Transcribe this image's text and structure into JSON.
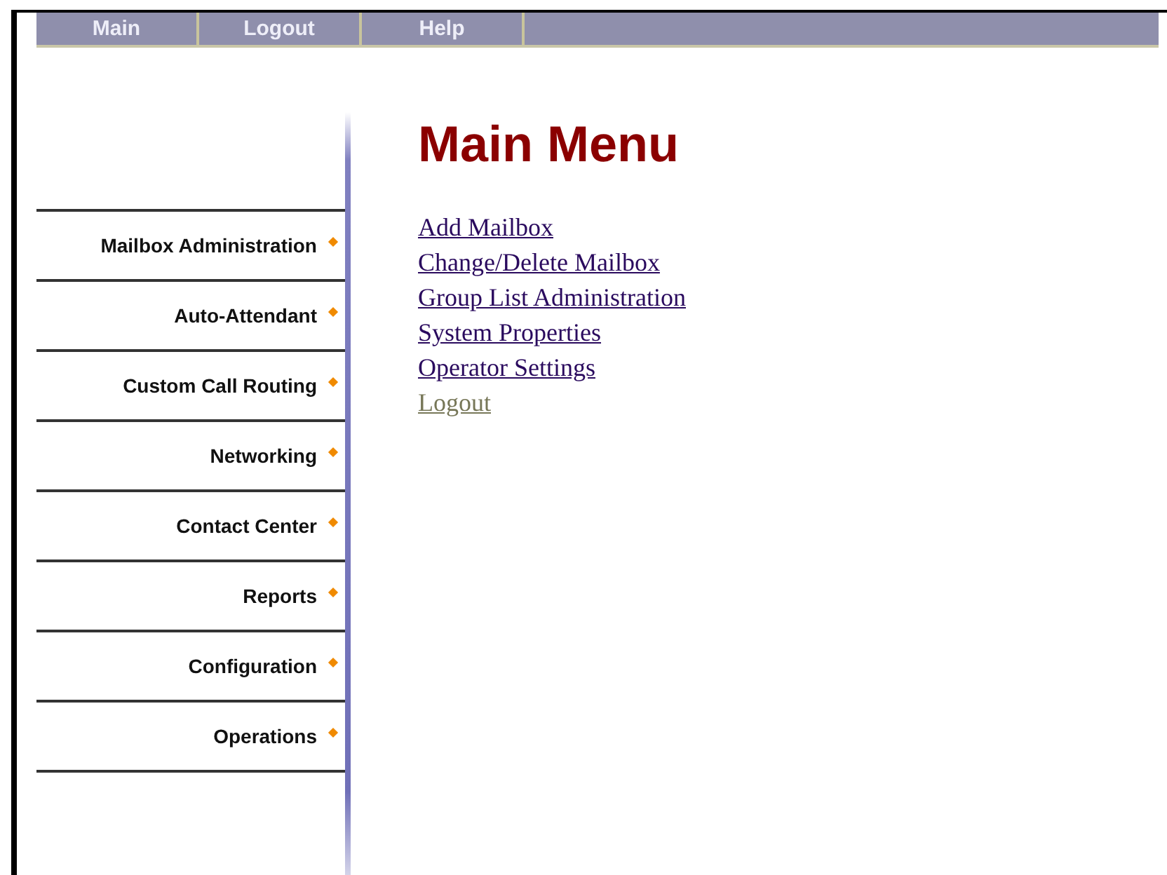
{
  "top_nav": [
    {
      "label": "Main"
    },
    {
      "label": "Logout"
    },
    {
      "label": "Help"
    }
  ],
  "sidebar": {
    "items": [
      {
        "label": "Mailbox Administration"
      },
      {
        "label": "Auto-Attendant"
      },
      {
        "label": "Custom Call Routing"
      },
      {
        "label": "Networking"
      },
      {
        "label": "Contact Center"
      },
      {
        "label": "Reports"
      },
      {
        "label": "Configuration"
      },
      {
        "label": "Operations"
      }
    ]
  },
  "main": {
    "title": "Main Menu",
    "links": [
      {
        "label": "Add Mailbox",
        "visited": false
      },
      {
        "label": "Change/Delete Mailbox",
        "visited": false
      },
      {
        "label": "Group List Administration",
        "visited": false
      },
      {
        "label": "System Properties",
        "visited": false
      },
      {
        "label": "Operator Settings",
        "visited": false
      },
      {
        "label": "Logout",
        "visited": true
      }
    ]
  }
}
